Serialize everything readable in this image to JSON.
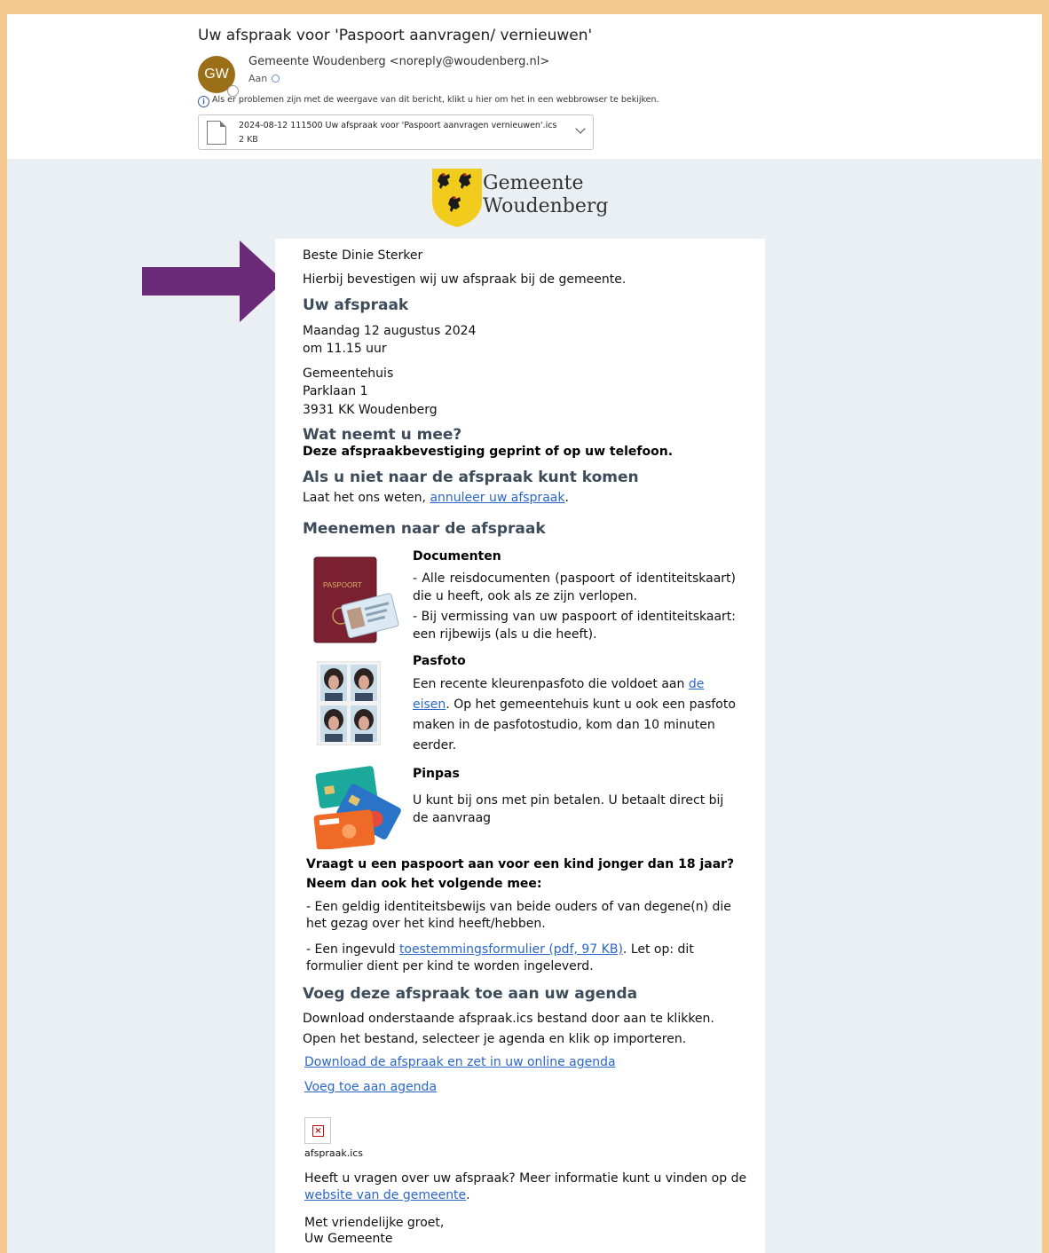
{
  "email": {
    "subject": "Uw afspraak voor 'Paspoort aanvragen/ vernieuwen'",
    "avatar_initials": "GW",
    "avatar_color": "#9b6e18",
    "sender": "Gemeente Woudenberg <noreply@woudenberg.nl>",
    "to_label": "Aan",
    "info_text": "Als er problemen zijn met de weergave van dit bericht, klikt u hier om het in een webbrowser te bekijken.",
    "attachment": {
      "name": "2024-08-12 111500 Uw afspraak voor 'Paspoort aanvragen vernieuwen'.ics",
      "size": "2 KB"
    }
  },
  "logo": {
    "line1": "Gemeente",
    "line2": "Woudenberg"
  },
  "body": {
    "greeting": "Beste Dinie Sterker",
    "intro": "Hierbij bevestigen wij uw afspraak bij de gemeente.",
    "appt_heading": "Uw afspraak",
    "date": "Maandag 12 augustus 2024",
    "time": "om 11.15 uur",
    "place": "Gemeentehuis",
    "street": "Parklaan 1",
    "city": "3931 KK Woudenberg",
    "bring_heading": "Wat neemt u mee?",
    "bring_text": "Deze afspraakbevestiging geprint of op uw telefoon.",
    "cancel_heading": "Als u niet naar de afspraak kunt komen",
    "cancel_prefix": "Laat het ons weten, ",
    "cancel_link": "annuleer uw afspraak",
    "cancel_suffix": ".",
    "take_heading": "Meenemen naar de afspraak",
    "documents_title": "Documenten",
    "documents_1": "- Alle reisdocumenten (paspoort of identiteitskaart) die u heeft, ook als ze zijn verlopen.",
    "documents_2": "- Bij vermissing van uw paspoort of identiteitskaart: een rijbewijs (als u die heeft).",
    "passport_label": "PASPOORT",
    "photo_title": "Pasfoto",
    "photo_prefix": "Een recente kleurenpasfoto die voldoet aan ",
    "photo_link": "de eisen",
    "photo_suffix": ". Op het gemeentehuis kunt u ook een pasfoto maken in de pasfotostudio, kom dan 10 minuten eerder.",
    "pin_title": "Pinpas",
    "pin_text": "U kunt bij ons met pin betalen. U betaalt direct bij de aanvraag",
    "child_heading": "Vraagt u een paspoort aan voor een kind jonger dan 18 jaar? Neem dan ook het volgende mee:",
    "child_1": "- Een geldig identiteitsbewijs van beide ouders of van degene(n) die het gezag over het kind heeft/hebben.",
    "child_2_prefix": "- Een ingevuld ",
    "child_2_link": "toestemmingsformulier (pdf, 97 KB)",
    "child_2_suffix": ". Let op: dit formulier dient per kind te worden ingeleverd.",
    "agenda_heading": "Voeg deze afspraak toe aan uw agenda",
    "agenda_text": "Download onderstaande afspraak.ics bestand door aan te klikken. Open het bestand, selecteer je agenda en klik op importeren.",
    "agenda_link1": "Download de afspraak en zet in uw online agenda",
    "agenda_link2": "Voeg toe aan agenda",
    "ics_label": "afspraak.ics",
    "questions_prefix": "Heeft u vragen over uw afspraak? Meer informatie kunt u vinden op de ",
    "questions_link": "website van de gemeente",
    "questions_suffix": ".",
    "closing": "Met vriendelijke groet,",
    "signature": "Uw Gemeente"
  }
}
